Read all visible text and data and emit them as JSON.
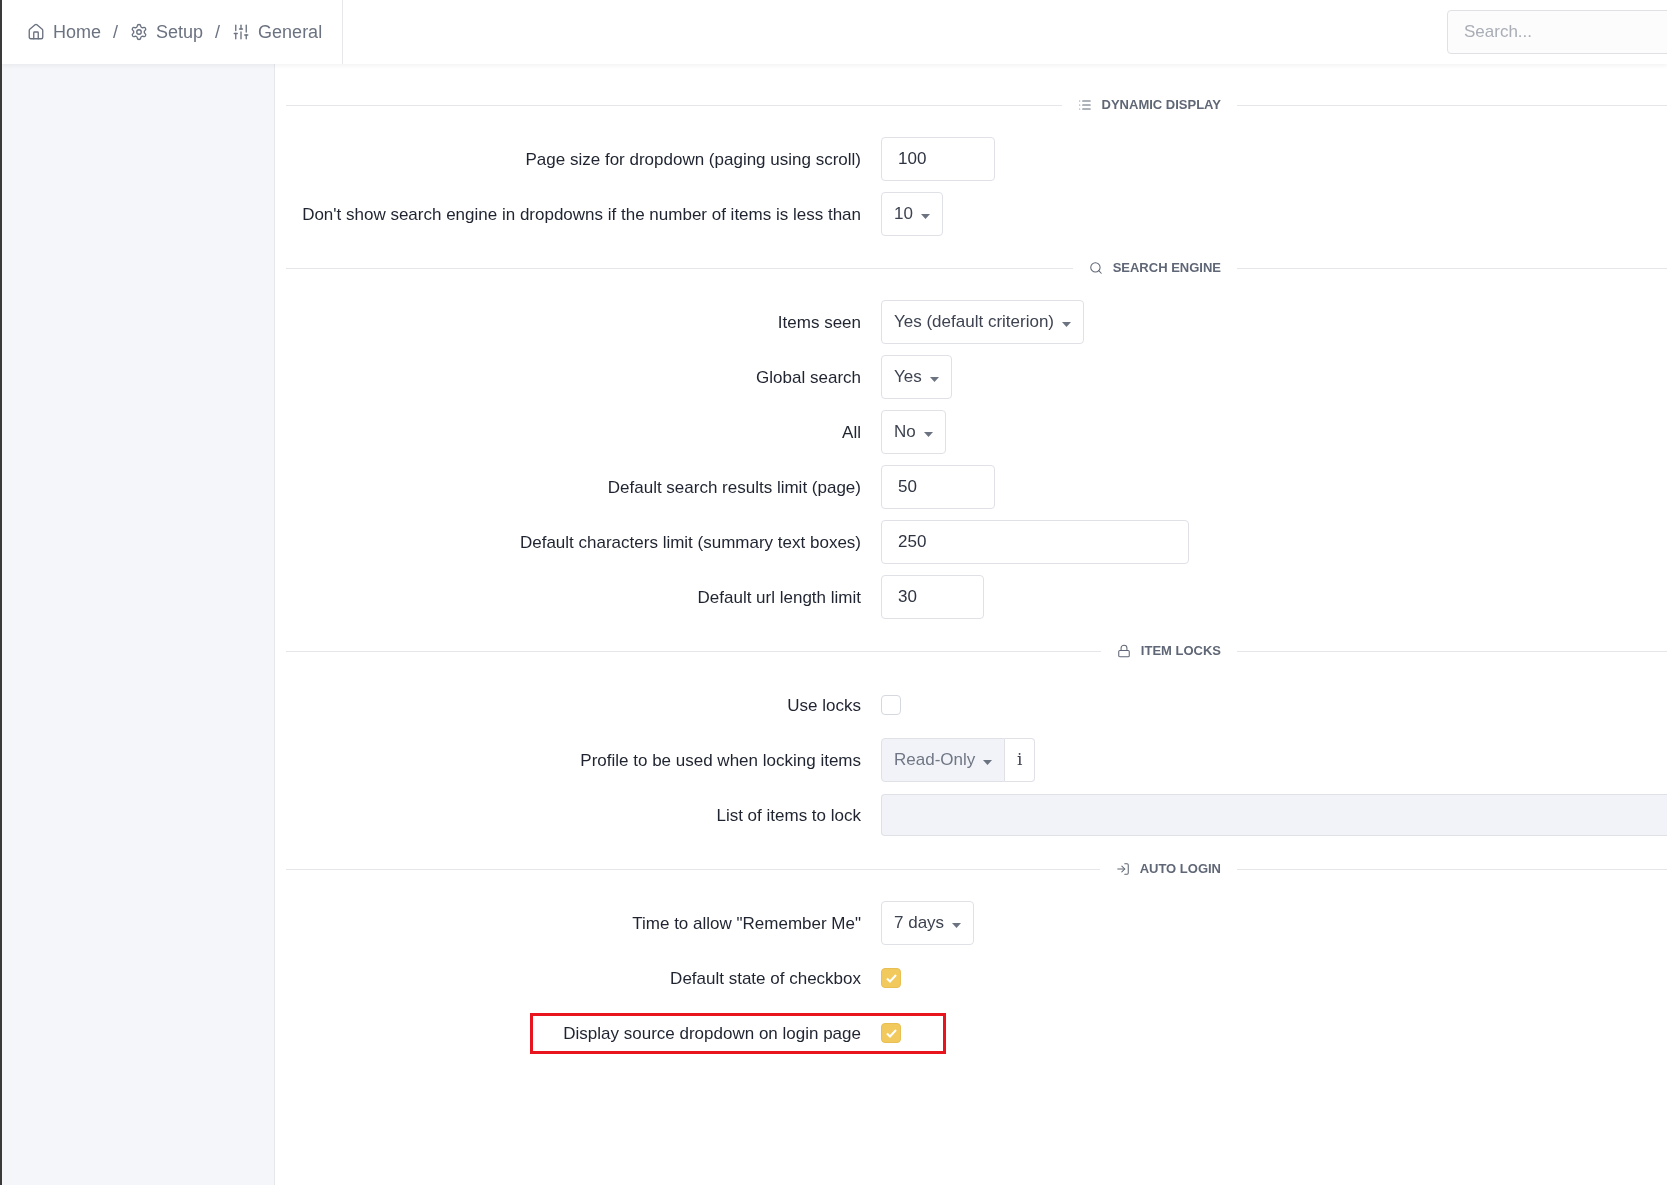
{
  "breadcrumb": [
    {
      "label": "Home",
      "kind": "home"
    },
    {
      "label": "Setup",
      "kind": "setup"
    },
    {
      "label": "General",
      "kind": "general"
    }
  ],
  "breadcrumb_separator": "/",
  "search": {
    "placeholder": "Search..."
  },
  "sections": [
    {
      "title": "DYNAMIC DISPLAY",
      "kind": "list",
      "rows": [
        {
          "label": "Page size for dropdown (paging using scroll)",
          "kind": "input",
          "value": "100"
        },
        {
          "label": "Don't show search engine in dropdowns if the number of items is less than",
          "kind": "select",
          "value": "10"
        }
      ]
    },
    {
      "title": "SEARCH ENGINE",
      "kind": "search",
      "rows": [
        {
          "label": "Items seen",
          "kind": "select",
          "value": "Yes (default criterion)"
        },
        {
          "label": "Global search",
          "kind": "select",
          "value": "Yes"
        },
        {
          "label": "All",
          "kind": "select",
          "value": "No"
        },
        {
          "label": "Default search results limit (page)",
          "kind": "input",
          "value": "50"
        },
        {
          "label": "Default characters limit (summary text boxes)",
          "kind": "input",
          "value": "250"
        },
        {
          "label": "Default url length limit",
          "kind": "input",
          "value": "30"
        }
      ]
    },
    {
      "title": "ITEM LOCKS",
      "kind": "lock",
      "rows": [
        {
          "label": "Use locks",
          "kind": "checkbox",
          "checked": false
        },
        {
          "label": "Profile to be used when locking items",
          "kind": "select_info",
          "value": "Read-Only",
          "info": "i",
          "disabled": true
        },
        {
          "label": "List of items to lock",
          "kind": "multiselect",
          "disabled": true
        }
      ]
    },
    {
      "title": "AUTO LOGIN",
      "kind": "login",
      "rows": [
        {
          "label": "Time to allow \"Remember Me\"",
          "kind": "select",
          "value": "7 days"
        },
        {
          "label": "Default state of checkbox",
          "kind": "checkbox",
          "checked": true,
          "highlighted": false
        },
        {
          "label": "Display source dropdown on login page",
          "kind": "checkbox",
          "checked": true,
          "highlighted": true
        }
      ]
    }
  ]
}
